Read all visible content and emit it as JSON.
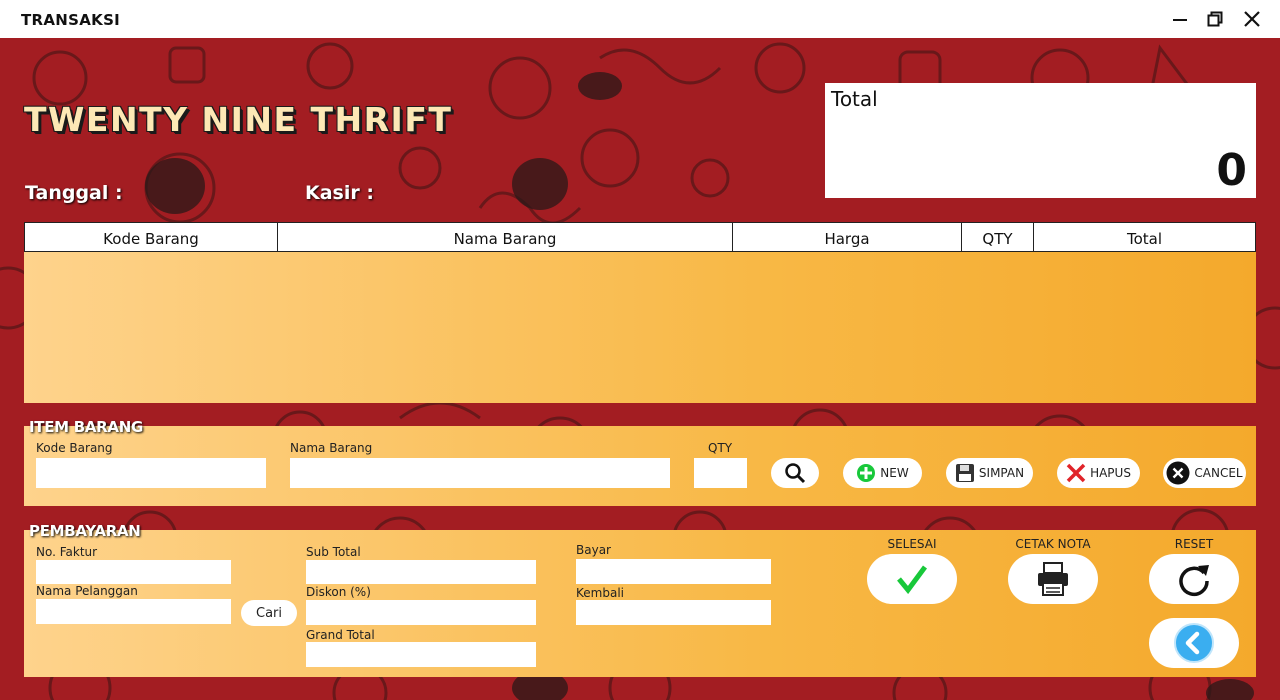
{
  "window": {
    "title": "TRANSAKSI"
  },
  "brand": "TWENTY NINE THRIFT",
  "labels": {
    "tanggal": "Tanggal :",
    "kasir": "Kasir :"
  },
  "total": {
    "label": "Total",
    "value": "0"
  },
  "table": {
    "columns": [
      "Kode Barang",
      "Nama Barang",
      "Harga",
      "QTY",
      "Total"
    ],
    "rows": []
  },
  "item_panel": {
    "title": "ITEM BARANG",
    "kode_label": "Kode Barang",
    "nama_label": "Nama Barang",
    "qty_label": "QTY",
    "buttons": {
      "new": "NEW",
      "simpan": "SIMPAN",
      "hapus": "HAPUS",
      "cancel": "CANCEL"
    }
  },
  "payment_panel": {
    "title": "PEMBAYARAN",
    "no_faktur": "No. Faktur",
    "nama_pelanggan": "Nama Pelanggan",
    "cari": "Cari",
    "sub_total": "Sub Total",
    "diskon": "Diskon (%)",
    "grand_total": "Grand Total",
    "bayar": "Bayar",
    "kembali": "Kembali",
    "actions": {
      "selesai": "SELESAI",
      "cetak": "CETAK NOTA",
      "reset": "RESET"
    }
  },
  "colors": {
    "background": "#a31d22",
    "panel_start": "#fed38c",
    "panel_end": "#f4a92c",
    "check": "#18c83a",
    "delete": "#e0242a",
    "back": "#3aaef0"
  }
}
